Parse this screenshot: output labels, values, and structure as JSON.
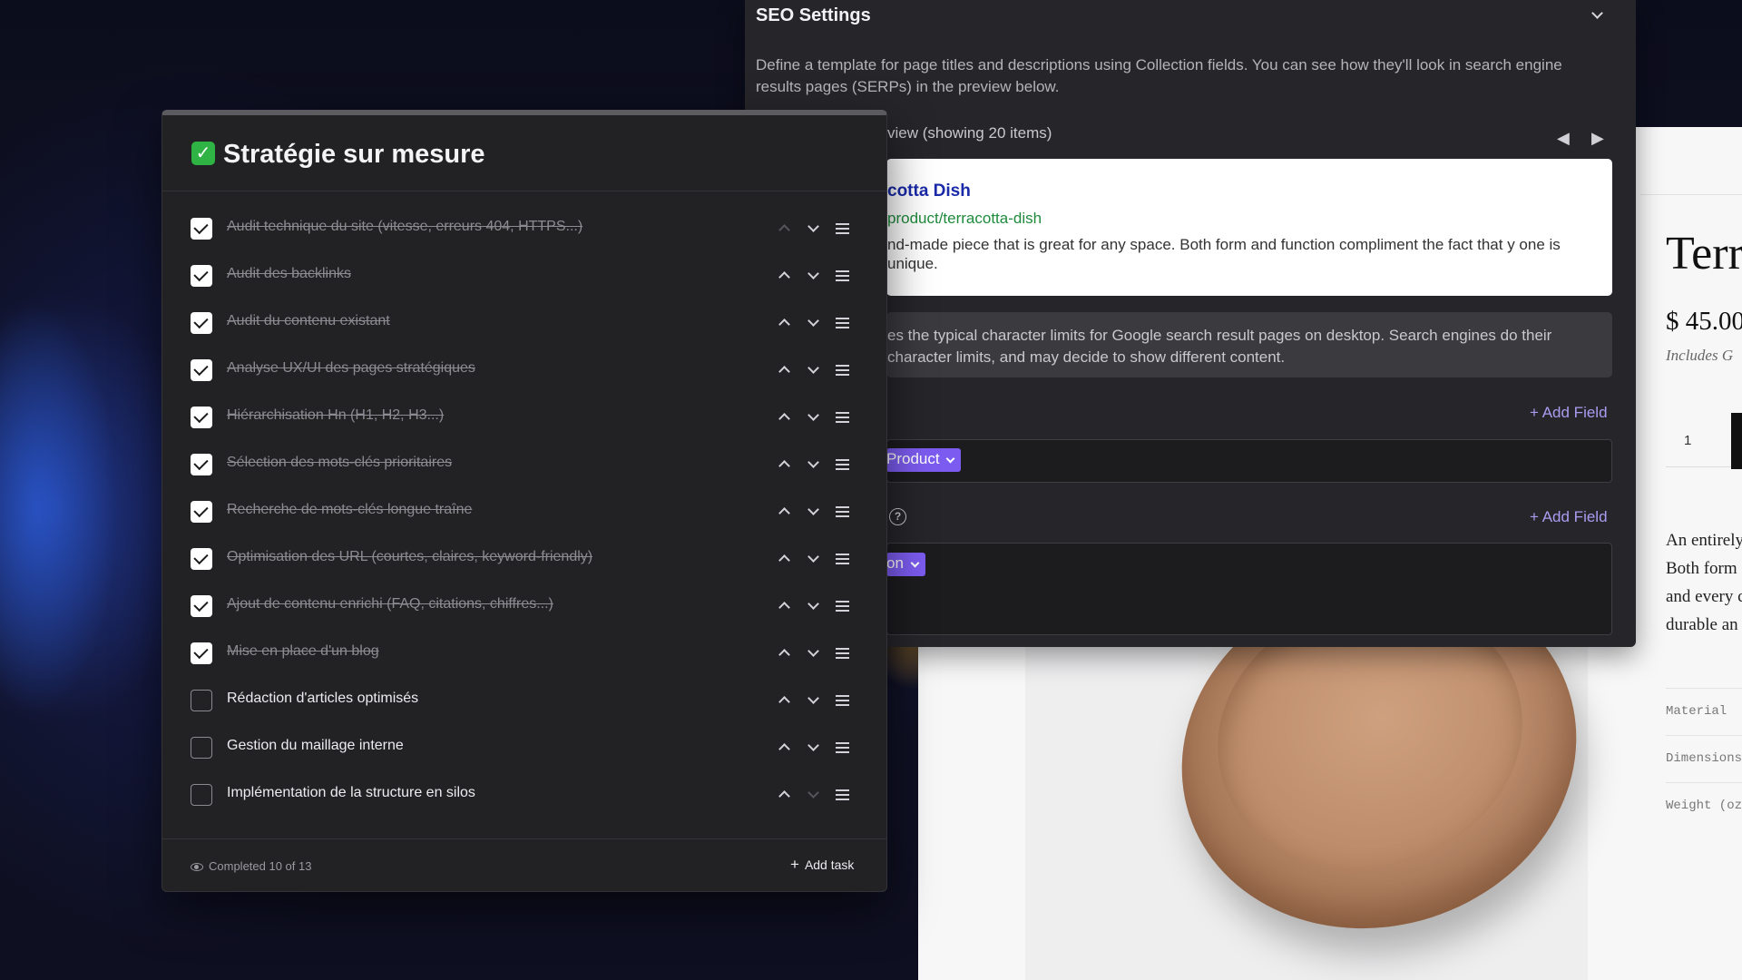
{
  "checklist": {
    "emoji": "✓",
    "title": "Stratégie sur mesure",
    "tasks": [
      {
        "label": "Audit technique du site (vitesse, erreurs 404, HTTPS...)",
        "done": true
      },
      {
        "label": "Audit des backlinks",
        "done": true
      },
      {
        "label": "Audit du contenu existant",
        "done": true
      },
      {
        "label": "Analyse UX/UI des pages stratégiques",
        "done": true
      },
      {
        "label": "Hiérarchisation Hn (H1, H2, H3...)",
        "done": true
      },
      {
        "label": "Sélection des mots-clés prioritaires",
        "done": true
      },
      {
        "label": "Recherche de mots-clés longue traîne",
        "done": true
      },
      {
        "label": "Optimisation des URL (courtes, claires, keyword-friendly)",
        "done": true
      },
      {
        "label": "Ajout de contenu enrichi (FAQ, citations, chiffres...)",
        "done": true
      },
      {
        "label": "Mise en place d'un blog",
        "done": true
      },
      {
        "label": "Rédaction d'articles optimisés",
        "done": false
      },
      {
        "label": "Gestion du maillage interne",
        "done": false
      },
      {
        "label": "Implémentation de la structure en silos",
        "done": false
      }
    ],
    "footer": {
      "completed_text": "Completed 10 of 13",
      "add_task_label": "Add task"
    }
  },
  "seo": {
    "title": "SEO Settings",
    "intro": "Define a template for page titles and descriptions using Collection fields. You can see how they'll look in search engine results pages (SERPs) in the preview below.",
    "preview_label": "view (showing 20 items)",
    "serp": {
      "title": "cotta Dish",
      "url": "product/terracotta-dish",
      "description": "nd-made piece that is great for any space. Both form and function compliment the fact that y one is unique."
    },
    "note": "es the typical character limits for Google search result pages on desktop. Search engines do their character limits, and may decide to show different content.",
    "add_field_label": "+ Add Field",
    "title_chip": "Product",
    "description_chip": "on"
  },
  "product_page": {
    "title": "Terr",
    "price": "$ 45.00",
    "tax_note": "Includes G",
    "quantity": "1",
    "description_lines": [
      "An entirely",
      "Both form",
      "and every c",
      "durable an"
    ],
    "specs": [
      "Material",
      "Dimensions",
      "Weight (oz"
    ]
  }
}
